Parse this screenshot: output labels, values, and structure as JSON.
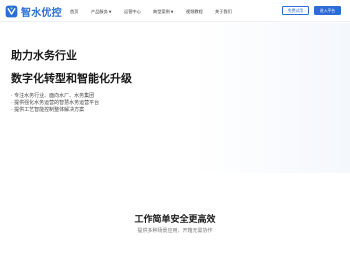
{
  "brand": {
    "name": "智水优控",
    "color": "#2a6fd6"
  },
  "nav": {
    "items": [
      {
        "label": "首页",
        "dropdown": false
      },
      {
        "label": "产品服务",
        "dropdown": true
      },
      {
        "label": "运营中心",
        "dropdown": false
      },
      {
        "label": "典型案例",
        "dropdown": true
      },
      {
        "label": "视频教程",
        "dropdown": false
      },
      {
        "label": "关于我们",
        "dropdown": false
      }
    ]
  },
  "header_buttons": {
    "trial": "免费试用",
    "login": "进入平台"
  },
  "hero": {
    "title_line1": "助力水务行业",
    "title_line2": "数字化转型和智能化升级",
    "bullets": [
      "· 专注水务行业、面向水厂、水务集团",
      "· 提供强化水务运营的智慧水务运营平台",
      "· 提供工艺智能控制整体解决方案"
    ]
  },
  "section": {
    "title": "工作简单安全更高效",
    "subtitle": "提供多种场景应用，开箱无需协作"
  }
}
